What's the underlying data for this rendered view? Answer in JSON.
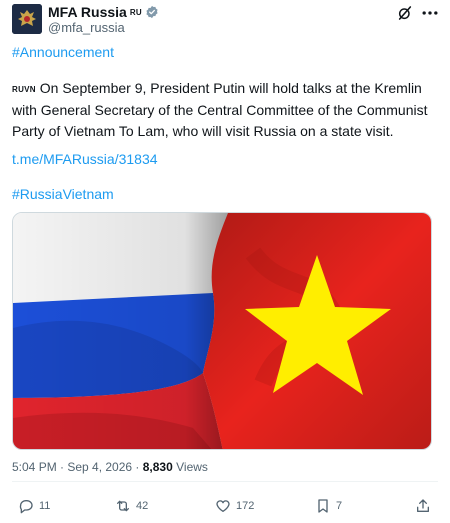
{
  "author": {
    "name": "MFA Russia",
    "country_tag": "RU",
    "handle": "@mfa_russia",
    "verified_icon": "verified-badge-icon"
  },
  "post": {
    "hashtag_announcement": "#Announcement",
    "country_tags": "RUVN",
    "text": " On September 9, President Putin will hold talks at the Kremlin with General Secretary of the Central Committee of the Communist Party of Vietnam To Lam, who will visit Russia on a state visit.",
    "link": "t.me/MFARussia/31834",
    "hashtag_topic": "#RussiaVietnam",
    "image_icon": "russia-vietnam-flags-image"
  },
  "meta": {
    "timestamp": "5:04 PM · Sep 4, 2026",
    "separator": " · ",
    "views_count": "8,830",
    "views_label": " Views"
  },
  "actions": {
    "replies": "11",
    "reposts": "42",
    "likes": "172",
    "bookmarks": "7"
  },
  "colors": {
    "link": "#1d9bf0",
    "muted": "#536471",
    "text": "#0f1419",
    "russia_white": "#ffffff",
    "russia_blue": "#1c4fd8",
    "russia_red": "#e0242d",
    "vietnam_red": "#e8231d",
    "vietnam_star": "#ffee00"
  }
}
